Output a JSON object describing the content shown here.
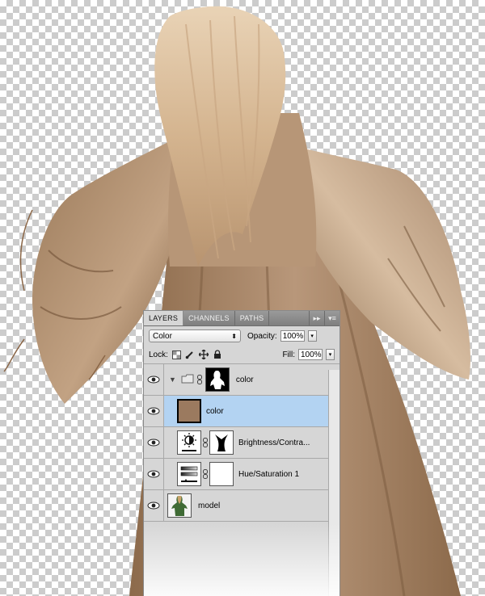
{
  "canvas": {
    "subject": "model"
  },
  "panel": {
    "tabs": [
      "LAYERS",
      "CHANNELS",
      "PATHS"
    ],
    "collapse_icon": "double-arrow-right-icon",
    "menu_icon": "panel-menu-icon",
    "blend_mode": "Color",
    "opacity_label": "Opacity:",
    "opacity_value": "100%",
    "lock_label": "Lock:",
    "fill_label": "Fill:",
    "fill_value": "100%",
    "layers": [
      {
        "name": "color",
        "kind": "group"
      },
      {
        "name": "color",
        "kind": "fill",
        "selected": true
      },
      {
        "name": "Brightness/Contra...",
        "kind": "adjustment"
      },
      {
        "name": "Hue/Saturation 1",
        "kind": "adjustment"
      },
      {
        "name": "model",
        "kind": "image"
      }
    ]
  },
  "colors": {
    "sepia_fill": "#9b7a5f",
    "selection": "#b3d3f2",
    "dress": "#a07d5d"
  }
}
